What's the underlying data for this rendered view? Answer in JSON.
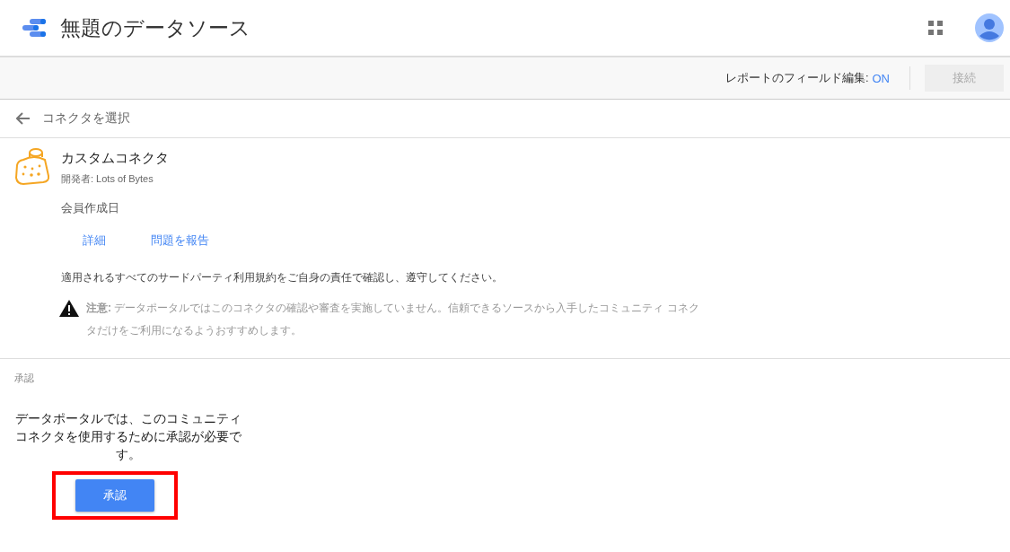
{
  "header": {
    "title": "無題のデータソース"
  },
  "toolbar": {
    "field_editing_label": "レポートのフィールド編集:",
    "field_editing_value": "ON",
    "field_editing_on": true,
    "connect_button": {
      "label": "接続",
      "disabled": true
    }
  },
  "back_link": {
    "label": "コネクタを選択"
  },
  "connector": {
    "name": "カスタムコネクタ",
    "developer": "開発者: Lots of Bytes",
    "created_by": "会員作成日",
    "links": [
      "詳細",
      "問題を報告"
    ],
    "terms": "適用されるすべてのサードパーティ利用規約をご自身の責任で確認し、遵守してください。",
    "caution": "**注意:** データポータルではこのコネクタの確認や審査を実施していません。信頼できるソースから入手したコミュニティ コネクタだけをご利用になるようおすすめします。"
  },
  "authorization": {
    "section_title": "承認",
    "message": "データポータルでは、このコミュニティコネクタを使用するために承認が必要です。",
    "button": {
      "label": "承認",
      "highlighted": true
    }
  }
}
